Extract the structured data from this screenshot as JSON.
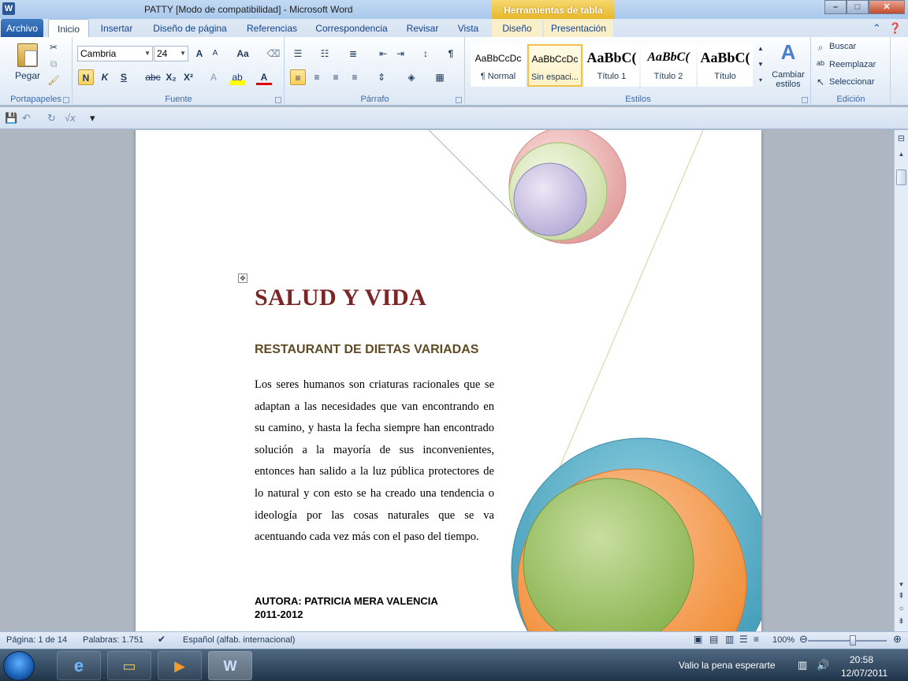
{
  "window": {
    "title": "PATTY [Modo de compatibilidad]  -  Microsoft Word",
    "context_tab_group": "Herramientas de tabla",
    "app_icon": "W"
  },
  "tabs": {
    "file": "Archivo",
    "items": [
      "Inicio",
      "Insertar",
      "Diseño de página",
      "Referencias",
      "Correspondencia",
      "Revisar",
      "Vista"
    ],
    "context": [
      "Diseño",
      "Presentación"
    ]
  },
  "ribbon": {
    "clipboard": {
      "paste": "Pegar",
      "label": "Portapapeles"
    },
    "font": {
      "name": "Cambria",
      "size": "24",
      "label": "Fuente",
      "bold": "N",
      "italic": "K",
      "underline": "S",
      "strike": "abc",
      "subscript": "X₂",
      "superscript": "X²",
      "grow": "A",
      "shrink": "A",
      "case": "Aa"
    },
    "paragraph": {
      "label": "Párrafo"
    },
    "styles": {
      "label": "Estilos",
      "items": [
        {
          "sample": "AaBbCcDc",
          "name": "¶ Normal"
        },
        {
          "sample": "AaBbCcDc",
          "name": "Sin espaci..."
        },
        {
          "sample": "AaBbC(",
          "name": "Título 1"
        },
        {
          "sample": "AaBbC(",
          "name": "Título 2"
        },
        {
          "sample": "AaBbC(",
          "name": "Título"
        }
      ],
      "change": "Cambiar estilos"
    },
    "editing": {
      "label": "Edición",
      "find": "Buscar",
      "replace": "Reemplazar",
      "select": "Seleccionar"
    }
  },
  "document": {
    "title": "SALUD Y VIDA",
    "subtitle": "RESTAURANT DE DIETAS VARIADAS",
    "body": "Los seres humanos son criaturas racionales que se adaptan a las necesidades que van encontrando en su camino, y hasta la fecha siempre han encontrado solución a la mayoría de sus inconvenientes, entonces han salido a la luz pública protectores de lo natural y con esto se ha creado una tendencia o ideología por las cosas naturales que se va acentuando cada vez más con el paso del tiempo.",
    "author": "AUTORA: PATRICIA MERA VALENCIA",
    "year": "2011-2012"
  },
  "statusbar": {
    "page": "Página: 1 de 14",
    "words": "Palabras: 1.751",
    "language": "Español (alfab. internacional)",
    "zoom": "100%"
  },
  "taskbar": {
    "tray_text": "Valio la pena esperarte",
    "time": "20:58",
    "date": "12/07/2011"
  },
  "colors": {
    "title_red": "#7b2527",
    "subtitle_brown": "#5f4b26",
    "circle_blue": "#5bb0c8",
    "circle_orange": "#f7a15a",
    "circle_green": "#9cc26a",
    "circle_pink": "#e8b0ae",
    "circle_lavender": "#cbc3e2"
  }
}
